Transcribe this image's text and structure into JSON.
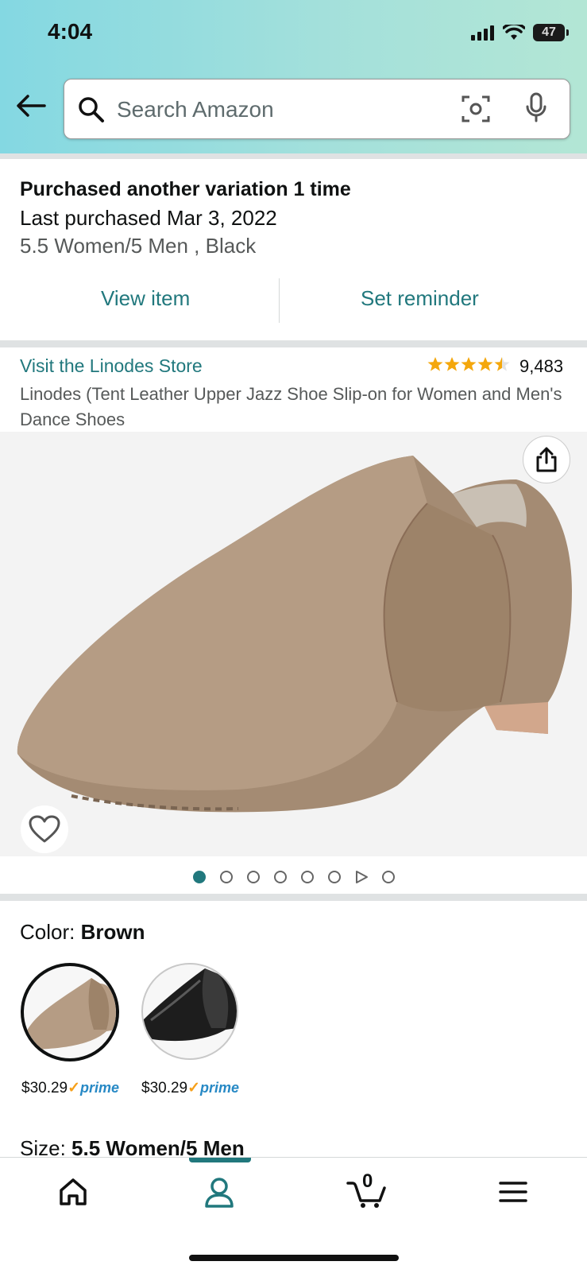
{
  "status": {
    "time": "4:04",
    "battery": "47"
  },
  "search": {
    "placeholder": "Search Amazon"
  },
  "purchase": {
    "title": "Purchased another variation 1 time",
    "last": "Last purchased Mar 3, 2022",
    "variation": "5.5 Women/5 Men , Black",
    "view_item": "View item",
    "set_reminder": "Set reminder"
  },
  "product": {
    "store": "Visit the Linodes Store",
    "rating": 4.5,
    "rating_count": "9,483",
    "title": "Linodes (Tent Leather Upper Jazz Shoe Slip-on for Women and Men's Dance Shoes"
  },
  "gallery": {
    "page_count": 8,
    "active_index": 0,
    "video_index": 6
  },
  "color": {
    "label": "Color: ",
    "value": "Brown",
    "options": [
      {
        "price": "$30.29",
        "prime": "prime",
        "selected": true
      },
      {
        "price": "$30.29",
        "prime": "prime",
        "selected": false
      }
    ]
  },
  "size": {
    "label": "Size: ",
    "value": "5.5 Women/5 Men"
  },
  "nav": {
    "cart_count": "0",
    "active": "account"
  },
  "colors": {
    "teal": "#21787d",
    "star": "#f4a70c",
    "prime": "#2789c5"
  }
}
